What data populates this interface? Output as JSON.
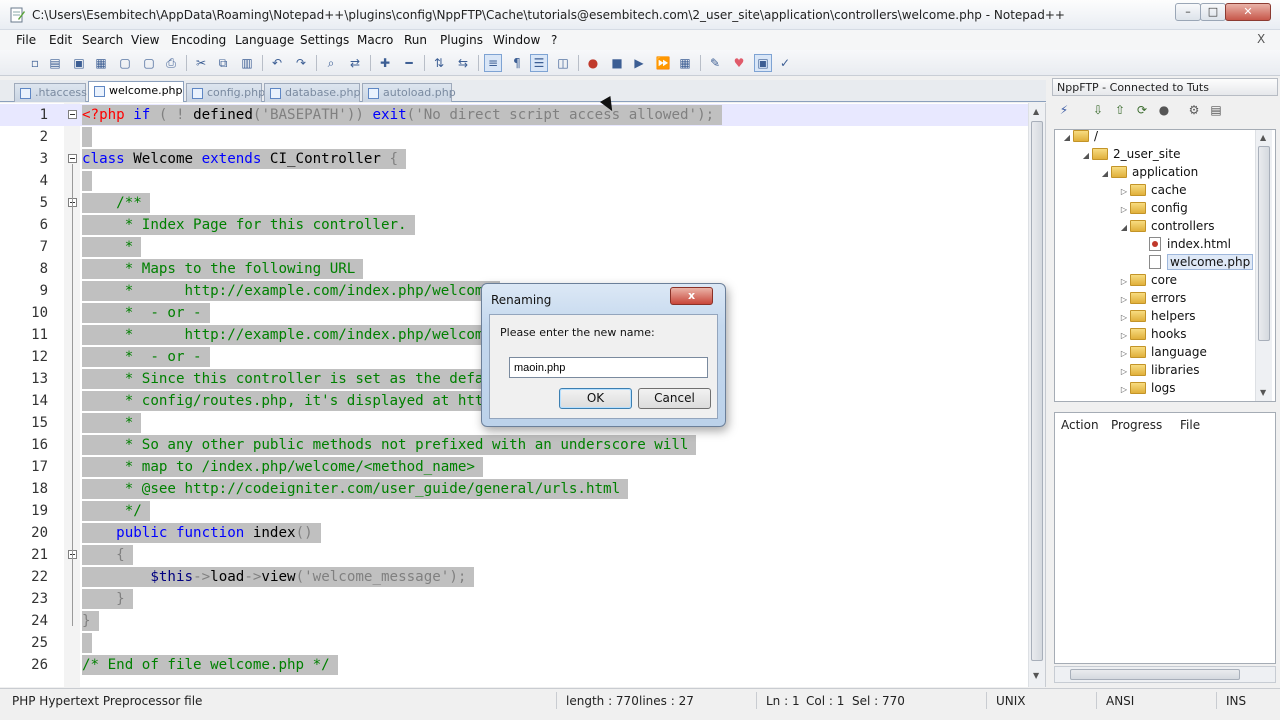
{
  "window": {
    "title": "C:\\Users\\Esembitech\\AppData\\Roaming\\Notepad++\\plugins\\config\\NppFTP\\Cache\\tutorials@esembitech.com\\2_user_site\\application\\controllers\\welcome.php - Notepad++",
    "min": "–",
    "max": "□",
    "close": "✕"
  },
  "menu": [
    "File",
    "Edit",
    "Search",
    "View",
    "Encoding",
    "Language",
    "Settings",
    "Macro",
    "Run",
    "Plugins",
    "Window",
    "?"
  ],
  "menu_close": "X",
  "tabs": [
    ".htaccess",
    "welcome.php",
    "config.php",
    "database.php",
    "autoload.php"
  ],
  "active_tab": 1,
  "editor": {
    "lines": [
      {
        "n": "1",
        "html": "<span class=\"ph\">&lt;?php</span> <span class=\"k\">if</span> <span class=\"s\">(</span> <span class=\"s\">!</span> defined<span class=\"s\">(</span><span class=\"s\">'BASEPATH'</span><span class=\"s\">))</span> <span class=\"k\">exit</span><span class=\"s\">(</span><span class=\"s\">'No direct script access allowed'</span><span class=\"s\">);</span>"
      },
      {
        "n": "2",
        "html": ""
      },
      {
        "n": "3",
        "html": "<span class=\"k\">class</span> Welcome <span class=\"k\">extends</span> CI_Controller <span class=\"s\">{</span>"
      },
      {
        "n": "4",
        "html": ""
      },
      {
        "n": "5",
        "html": "    <span class=\"c\">/**</span>"
      },
      {
        "n": "6",
        "html": "     <span class=\"c\">* Index Page for this controller.</span>"
      },
      {
        "n": "7",
        "html": "     <span class=\"c\">*</span>"
      },
      {
        "n": "8",
        "html": "     <span class=\"c\">* Maps to the following URL</span>"
      },
      {
        "n": "9",
        "html": "     <span class=\"c\">*      http://example.com/index.php/welcome</span>"
      },
      {
        "n": "10",
        "html": "     <span class=\"c\">*  - or -</span>"
      },
      {
        "n": "11",
        "html": "     <span class=\"c\">*      http://example.com/index.php/welcome/index</span>"
      },
      {
        "n": "12",
        "html": "     <span class=\"c\">*  - or -</span>"
      },
      {
        "n": "13",
        "html": "     <span class=\"c\">* Since this controller is set as the default controller in</span>"
      },
      {
        "n": "14",
        "html": "     <span class=\"c\">* config/routes.php, it's displayed at http://example.com/</span>"
      },
      {
        "n": "15",
        "html": "     <span class=\"c\">*</span>"
      },
      {
        "n": "16",
        "html": "     <span class=\"c\">* So any other public methods not prefixed with an underscore will</span>"
      },
      {
        "n": "17",
        "html": "     <span class=\"c\">* map to /index.php/welcome/&lt;method_name&gt;</span>"
      },
      {
        "n": "18",
        "html": "     <span class=\"c\">* @see http://codeigniter.com/user_guide/general/urls.html</span>"
      },
      {
        "n": "19",
        "html": "     <span class=\"c\">*/</span>"
      },
      {
        "n": "20",
        "html": "    <span class=\"k\">public</span> <span class=\"k\">function</span> index<span class=\"s\">()</span>"
      },
      {
        "n": "21",
        "html": "    <span class=\"s\">{</span>"
      },
      {
        "n": "22",
        "html": "        <span class=\"v\">$this</span><span class=\"s\">-&gt;</span>load<span class=\"s\">-&gt;</span>view<span class=\"s\">(</span><span class=\"s\">'welcome_message'</span><span class=\"s\">);</span>"
      },
      {
        "n": "23",
        "html": "    <span class=\"s\">}</span>"
      },
      {
        "n": "24",
        "html": "<span class=\"s\">}</span>"
      },
      {
        "n": "25",
        "html": ""
      },
      {
        "n": "26",
        "html": "<span class=\"c\">/* End of file welcome.php */</span>"
      }
    ]
  },
  "ftp_panel": {
    "title": "NppFTP - Connected to Tuts",
    "tree": [
      {
        "label": "/",
        "depth": 0,
        "tri": "◢",
        "kind": "folder"
      },
      {
        "label": "2_user_site",
        "depth": 1,
        "tri": "◢",
        "kind": "folder"
      },
      {
        "label": "application",
        "depth": 2,
        "tri": "◢",
        "kind": "folder"
      },
      {
        "label": "cache",
        "depth": 3,
        "tri": "▷",
        "kind": "folder"
      },
      {
        "label": "config",
        "depth": 3,
        "tri": "▷",
        "kind": "folder"
      },
      {
        "label": "controllers",
        "depth": 3,
        "tri": "◢",
        "kind": "folder"
      },
      {
        "label": "index.html",
        "depth": 4,
        "tri": "",
        "kind": "html"
      },
      {
        "label": "welcome.php",
        "depth": 4,
        "tri": "",
        "kind": "php",
        "selected": true
      },
      {
        "label": "core",
        "depth": 3,
        "tri": "▷",
        "kind": "folder"
      },
      {
        "label": "errors",
        "depth": 3,
        "tri": "▷",
        "kind": "folder"
      },
      {
        "label": "helpers",
        "depth": 3,
        "tri": "▷",
        "kind": "folder"
      },
      {
        "label": "hooks",
        "depth": 3,
        "tri": "▷",
        "kind": "folder"
      },
      {
        "label": "language",
        "depth": 3,
        "tri": "▷",
        "kind": "folder"
      },
      {
        "label": "libraries",
        "depth": 3,
        "tri": "▷",
        "kind": "folder"
      },
      {
        "label": "logs",
        "depth": 3,
        "tri": "▷",
        "kind": "folder"
      }
    ],
    "queue_headers": [
      "Action",
      "Progress",
      "File"
    ]
  },
  "status": {
    "filetype": "PHP Hypertext Preprocessor file",
    "length": "length : 770",
    "lines": "lines : 27",
    "ln": "Ln : 1",
    "col": "Col : 1",
    "sel": "Sel : 770",
    "eol": "UNIX",
    "encoding": "ANSI",
    "mode": "INS"
  },
  "dialog": {
    "title": "Renaming",
    "close": "x",
    "prompt": "Please enter the new name:",
    "value": "maoin.php",
    "ok": "OK",
    "cancel": "Cancel"
  }
}
